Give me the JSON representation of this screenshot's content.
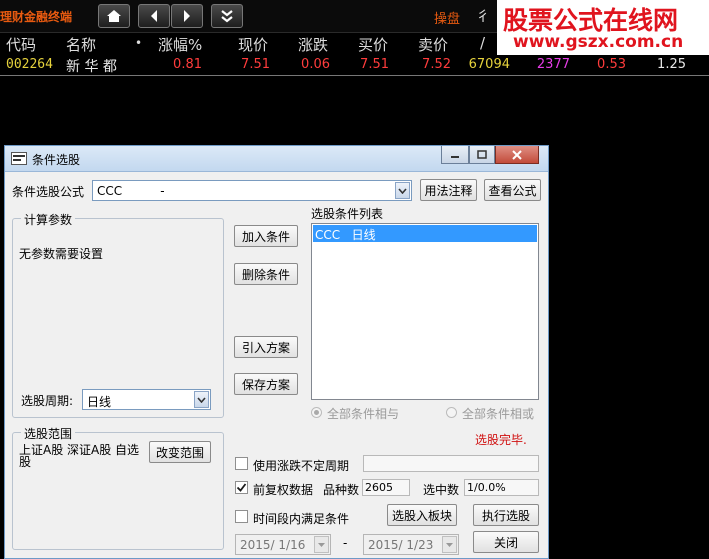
{
  "toolbar": {
    "app_title": "理财金融终端",
    "trade_link": "操盘",
    "cut_text": "彳"
  },
  "watermark": {
    "line1": "股票公式在线网",
    "line2": "www.gszx.com.cn"
  },
  "quote": {
    "headers": [
      "代码",
      "名称",
      "•",
      "涨幅%",
      "现价",
      "涨跌",
      "买价",
      "卖价",
      "/"
    ],
    "row": {
      "code": "002264",
      "name": "新 华 都",
      "change_pct": "0.81",
      "price": "7.51",
      "change": "0.06",
      "bid": "7.51",
      "ask": "7.52",
      "volume": "67094",
      "current_volume": "2377",
      "speed": "0.53",
      "turnover": "1.25"
    },
    "colors": {
      "red": "#ff3c3c",
      "yellow": "#e6d23c",
      "magenta": "#e63ce6",
      "white": "#e8e8e8"
    }
  },
  "dialog": {
    "title": "条件选股",
    "formula_label": "条件选股公式",
    "formula_value": "CCC          -",
    "usage_button": "用法注释",
    "view_formula_button": "查看公式",
    "params_group": "计算参数",
    "no_params_text": "无参数需要设置",
    "period_label": "选股周期:",
    "period_value": "日线",
    "add_condition": "加入条件",
    "delete_condition": "删除条件",
    "import_scheme": "引入方案",
    "save_scheme": "保存方案",
    "list_label": "选股条件列表",
    "list_items": [
      "CCC   日线"
    ],
    "radio_and": "全部条件相与",
    "radio_or": "全部条件相或",
    "status": "选股完毕.",
    "scope_group": "选股范围",
    "scope_text": "上证A股 深证A股 自选股",
    "change_scope": "改变范围",
    "use_variable_period": "使用涨跌不定周期",
    "prior_adjust": "前复权数据",
    "stock_count_label": "品种数",
    "stock_count": "2605",
    "selected_label": "选中数",
    "selected_value": "1/0.0%",
    "time_range": "时间段内满足条件",
    "to_block": "选股入板块",
    "run_select": "执行选股",
    "close": "关闭",
    "date_from": "2015/ 1/16",
    "date_sep": "-",
    "date_to": "2015/ 1/23",
    "status_color": "#d01010"
  }
}
